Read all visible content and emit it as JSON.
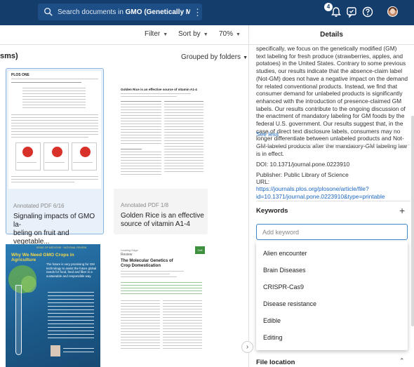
{
  "search": {
    "prefix": "Search documents in ",
    "bold": "GMO (Genetically Modified ..."
  },
  "header": {
    "notification_count": "4"
  },
  "toolbar": {
    "filter": "Filter",
    "sort": "Sort by",
    "zoom": "70%"
  },
  "main": {
    "section_title": "sms)",
    "grouped_label": "Grouped by folders",
    "cards": [
      {
        "meta": "Annotated PDF  6/16",
        "title_line1": "Signaling impacts of GMO la-",
        "title_line2": "beling on fruit and vegetable..."
      },
      {
        "meta": "Annotated PDF  1/8",
        "title_line1": "Golden Rice is an effective",
        "title_line2": "source of vitamin A1-4"
      }
    ],
    "thumb1": {
      "header": "PLOS ONE"
    },
    "thumb2": {
      "title": "Golden Rice is an effective source of vitamin A1-4"
    },
    "thumb3": {
      "title": "Why We Need GMO Crops in Agriculture",
      "kicker": "ISSUE OF MEDICINE · NATIONAL REVIEW",
      "body": "The future is very promising for GM technology to assist the future global needs for food, feed and fiber in a sustainable and responsible way."
    },
    "thumb4": {
      "title": "The Molecular Genetics of Crop Domestication",
      "kicker": "Leading Edge",
      "sub": "Review",
      "tag": "Cell"
    }
  },
  "details": {
    "title": "Details",
    "abstract": "specifically, we focus on the genetically modified (GM) text labeling for fresh produce (strawberries, apples, and potatoes) in the United States. Contrary to some previous studies, our results indicate that the absence-claim label (Not-GM) does not have a negative impact on the demand for related conventional products. Instead, we find that consumer demand for unlabeled products is significantly enhanced with the introduction of presence-claimed GM labels. Our results contribute to the ongoing discussion of the enactment of mandatory labeling for GM foods by the federal U.S. government. Our results suggest that, in the case of direct text disclosure labels, consumers may no longer differentiate between unlabeled products and Not-GM-labeled products after the mandatory-GM labeling law is in effect.",
    "see_less": "See less",
    "publisher_label": "Publisher:",
    "publisher": "Public Library of Science",
    "doi_label": "DOI:",
    "doi": "10.1371/journal.pone.0223910",
    "url_label": "URL:",
    "url": "https://journals.plos.org/plosone/article/file?id=10.1371/journal.pone.0223910&type=printable",
    "keywords_title": "Keywords",
    "keyword_placeholder": "Add keyword",
    "keyword_options": [
      "Alien encounter",
      "Brain Diseases",
      "CRISPR-Cas9",
      "Disease resistance",
      "Edible",
      "Editing"
    ],
    "file_location": "File location"
  }
}
